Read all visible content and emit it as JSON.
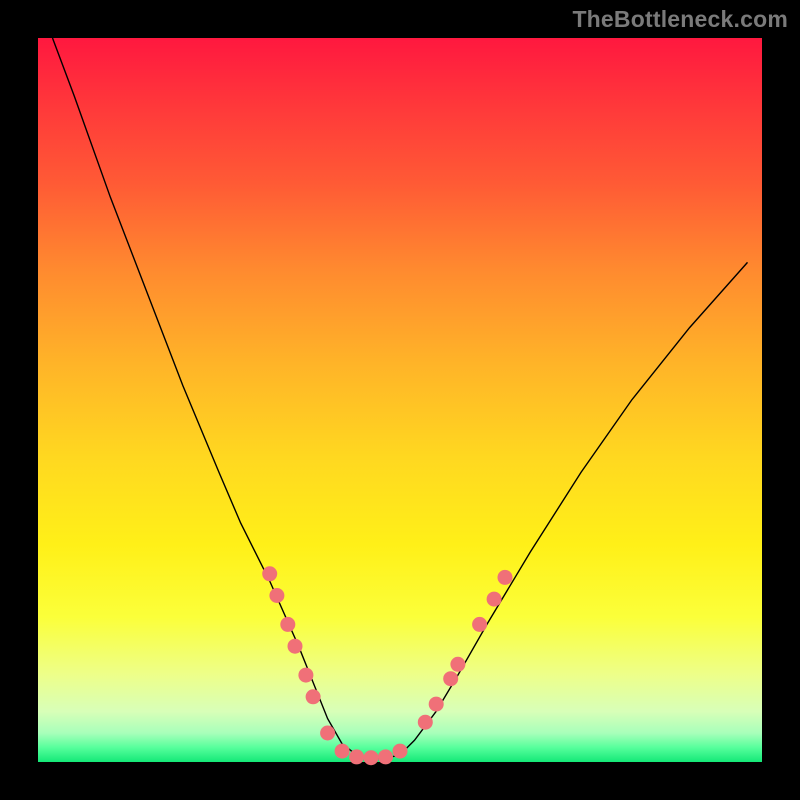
{
  "watermark": "TheBottleneck.com",
  "colors": {
    "background": "#000000",
    "curve": "#000000",
    "dots": "#f07078"
  },
  "chart_data": {
    "type": "line",
    "title": "",
    "xlabel": "",
    "ylabel": "",
    "xlim": [
      0,
      100
    ],
    "ylim": [
      0,
      100
    ],
    "series": [
      {
        "name": "bottleneck-curve",
        "x": [
          2,
          5,
          10,
          15,
          20,
          25,
          28,
          32,
          36,
          38,
          40,
          42,
          44,
          46,
          48,
          50,
          52,
          55,
          58,
          62,
          68,
          75,
          82,
          90,
          98
        ],
        "y": [
          100,
          92,
          78,
          65,
          52,
          40,
          33,
          25,
          16,
          11,
          6,
          2.5,
          1,
          0.5,
          0.5,
          1,
          3,
          7,
          12,
          19,
          29,
          40,
          50,
          60,
          69
        ]
      }
    ],
    "markers": [
      {
        "x": 32,
        "y": 26
      },
      {
        "x": 33,
        "y": 23
      },
      {
        "x": 34.5,
        "y": 19
      },
      {
        "x": 35.5,
        "y": 16
      },
      {
        "x": 37,
        "y": 12
      },
      {
        "x": 38,
        "y": 9
      },
      {
        "x": 40,
        "y": 4
      },
      {
        "x": 42,
        "y": 1.5
      },
      {
        "x": 44,
        "y": 0.7
      },
      {
        "x": 46,
        "y": 0.6
      },
      {
        "x": 48,
        "y": 0.7
      },
      {
        "x": 50,
        "y": 1.5
      },
      {
        "x": 53.5,
        "y": 5.5
      },
      {
        "x": 55,
        "y": 8
      },
      {
        "x": 57,
        "y": 11.5
      },
      {
        "x": 58,
        "y": 13.5
      },
      {
        "x": 61,
        "y": 19
      },
      {
        "x": 63,
        "y": 22.5
      },
      {
        "x": 64.5,
        "y": 25.5
      }
    ]
  }
}
